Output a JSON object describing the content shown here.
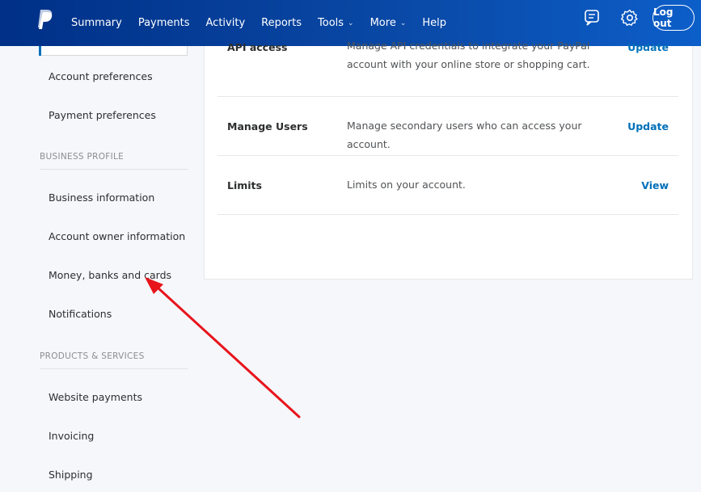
{
  "header": {
    "nav": [
      {
        "label": "Summary",
        "has_menu": false
      },
      {
        "label": "Payments",
        "has_menu": false
      },
      {
        "label": "Activity",
        "has_menu": false
      },
      {
        "label": "Reports",
        "has_menu": false
      },
      {
        "label": "Tools",
        "has_menu": true
      },
      {
        "label": "More",
        "has_menu": true
      },
      {
        "label": "Help",
        "has_menu": false
      }
    ],
    "icons": [
      "message-center-icon",
      "settings-gear-icon"
    ],
    "logout_label": "Log out",
    "brand_color": "#003087"
  },
  "sidebar": {
    "account_links": [
      "Account preferences",
      "Payment preferences"
    ],
    "business_heading": "BUSINESS PROFILE",
    "business_links": [
      "Business information",
      "Account owner information",
      "Money, banks and cards",
      "Notifications"
    ],
    "products_heading": "PRODUCTS & SERVICES",
    "products_links": [
      "Website payments",
      "Invoicing",
      "Shipping"
    ]
  },
  "main": {
    "rows": [
      {
        "title": "API access",
        "desc": "Manage API credentials to integrate your PayPal account with your online store or shopping cart.",
        "action": "Update"
      },
      {
        "title": "Manage Users",
        "desc": "Manage secondary users who can access your account.",
        "action": "Update"
      },
      {
        "title": "Limits",
        "desc": "Limits on your account.",
        "action": "View"
      }
    ],
    "link_color": "#0070ba"
  },
  "annotation": {
    "arrow_color": "#e8141c"
  }
}
